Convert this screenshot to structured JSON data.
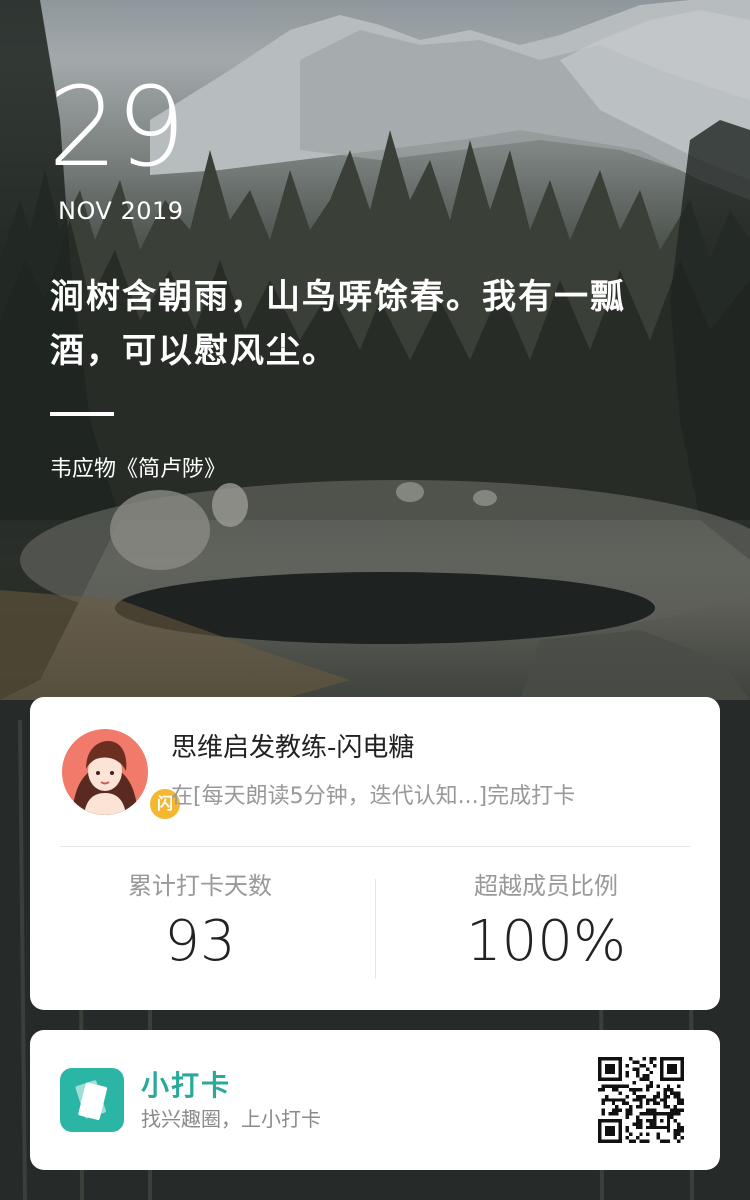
{
  "date": {
    "day": "29",
    "month_year": "NOV 2019"
  },
  "poem": {
    "line1": "涧树含朝雨，山鸟哢馀春。我有一瓢",
    "line2": "酒，可以慰风尘。",
    "source": "韦应物《简卢陟》"
  },
  "user": {
    "avatar_badge": "闪",
    "name": "思维启发教练-闪电糖",
    "status": "在[每天朗读5分钟，迭代认知...]完成打卡"
  },
  "stats": {
    "days_label": "累计打卡天数",
    "days_value": "93",
    "surpass_label": "超越成员比例",
    "surpass_value": "100%"
  },
  "brand": {
    "name": "小打卡",
    "slogan": "找兴趣圈，上小打卡",
    "logo_icon": "card-stack-icon",
    "accent": "#2bb5a4"
  }
}
